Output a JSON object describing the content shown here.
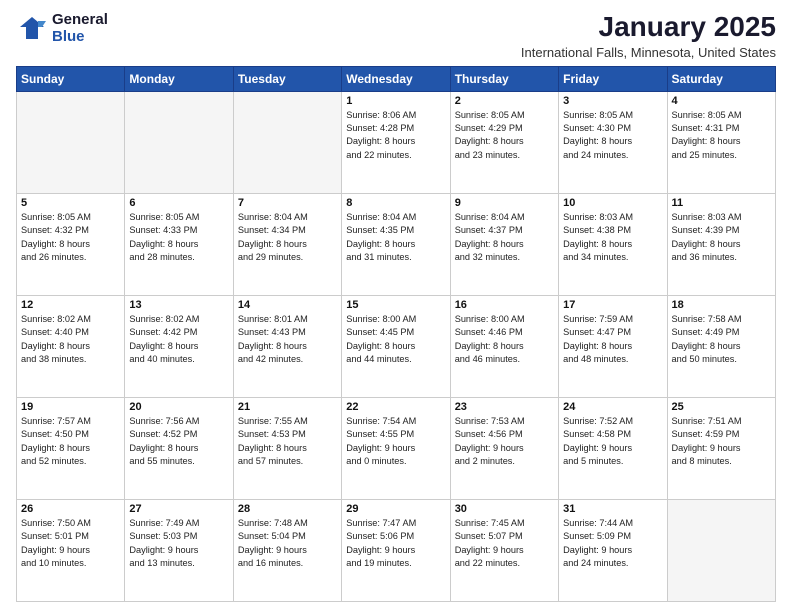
{
  "header": {
    "logo_general": "General",
    "logo_blue": "Blue",
    "month_title": "January 2025",
    "location": "International Falls, Minnesota, United States"
  },
  "days_of_week": [
    "Sunday",
    "Monday",
    "Tuesday",
    "Wednesday",
    "Thursday",
    "Friday",
    "Saturday"
  ],
  "weeks": [
    [
      {
        "day": "",
        "info": ""
      },
      {
        "day": "",
        "info": ""
      },
      {
        "day": "",
        "info": ""
      },
      {
        "day": "1",
        "info": "Sunrise: 8:06 AM\nSunset: 4:28 PM\nDaylight: 8 hours\nand 22 minutes."
      },
      {
        "day": "2",
        "info": "Sunrise: 8:05 AM\nSunset: 4:29 PM\nDaylight: 8 hours\nand 23 minutes."
      },
      {
        "day": "3",
        "info": "Sunrise: 8:05 AM\nSunset: 4:30 PM\nDaylight: 8 hours\nand 24 minutes."
      },
      {
        "day": "4",
        "info": "Sunrise: 8:05 AM\nSunset: 4:31 PM\nDaylight: 8 hours\nand 25 minutes."
      }
    ],
    [
      {
        "day": "5",
        "info": "Sunrise: 8:05 AM\nSunset: 4:32 PM\nDaylight: 8 hours\nand 26 minutes."
      },
      {
        "day": "6",
        "info": "Sunrise: 8:05 AM\nSunset: 4:33 PM\nDaylight: 8 hours\nand 28 minutes."
      },
      {
        "day": "7",
        "info": "Sunrise: 8:04 AM\nSunset: 4:34 PM\nDaylight: 8 hours\nand 29 minutes."
      },
      {
        "day": "8",
        "info": "Sunrise: 8:04 AM\nSunset: 4:35 PM\nDaylight: 8 hours\nand 31 minutes."
      },
      {
        "day": "9",
        "info": "Sunrise: 8:04 AM\nSunset: 4:37 PM\nDaylight: 8 hours\nand 32 minutes."
      },
      {
        "day": "10",
        "info": "Sunrise: 8:03 AM\nSunset: 4:38 PM\nDaylight: 8 hours\nand 34 minutes."
      },
      {
        "day": "11",
        "info": "Sunrise: 8:03 AM\nSunset: 4:39 PM\nDaylight: 8 hours\nand 36 minutes."
      }
    ],
    [
      {
        "day": "12",
        "info": "Sunrise: 8:02 AM\nSunset: 4:40 PM\nDaylight: 8 hours\nand 38 minutes."
      },
      {
        "day": "13",
        "info": "Sunrise: 8:02 AM\nSunset: 4:42 PM\nDaylight: 8 hours\nand 40 minutes."
      },
      {
        "day": "14",
        "info": "Sunrise: 8:01 AM\nSunset: 4:43 PM\nDaylight: 8 hours\nand 42 minutes."
      },
      {
        "day": "15",
        "info": "Sunrise: 8:00 AM\nSunset: 4:45 PM\nDaylight: 8 hours\nand 44 minutes."
      },
      {
        "day": "16",
        "info": "Sunrise: 8:00 AM\nSunset: 4:46 PM\nDaylight: 8 hours\nand 46 minutes."
      },
      {
        "day": "17",
        "info": "Sunrise: 7:59 AM\nSunset: 4:47 PM\nDaylight: 8 hours\nand 48 minutes."
      },
      {
        "day": "18",
        "info": "Sunrise: 7:58 AM\nSunset: 4:49 PM\nDaylight: 8 hours\nand 50 minutes."
      }
    ],
    [
      {
        "day": "19",
        "info": "Sunrise: 7:57 AM\nSunset: 4:50 PM\nDaylight: 8 hours\nand 52 minutes."
      },
      {
        "day": "20",
        "info": "Sunrise: 7:56 AM\nSunset: 4:52 PM\nDaylight: 8 hours\nand 55 minutes."
      },
      {
        "day": "21",
        "info": "Sunrise: 7:55 AM\nSunset: 4:53 PM\nDaylight: 8 hours\nand 57 minutes."
      },
      {
        "day": "22",
        "info": "Sunrise: 7:54 AM\nSunset: 4:55 PM\nDaylight: 9 hours\nand 0 minutes."
      },
      {
        "day": "23",
        "info": "Sunrise: 7:53 AM\nSunset: 4:56 PM\nDaylight: 9 hours\nand 2 minutes."
      },
      {
        "day": "24",
        "info": "Sunrise: 7:52 AM\nSunset: 4:58 PM\nDaylight: 9 hours\nand 5 minutes."
      },
      {
        "day": "25",
        "info": "Sunrise: 7:51 AM\nSunset: 4:59 PM\nDaylight: 9 hours\nand 8 minutes."
      }
    ],
    [
      {
        "day": "26",
        "info": "Sunrise: 7:50 AM\nSunset: 5:01 PM\nDaylight: 9 hours\nand 10 minutes."
      },
      {
        "day": "27",
        "info": "Sunrise: 7:49 AM\nSunset: 5:03 PM\nDaylight: 9 hours\nand 13 minutes."
      },
      {
        "day": "28",
        "info": "Sunrise: 7:48 AM\nSunset: 5:04 PM\nDaylight: 9 hours\nand 16 minutes."
      },
      {
        "day": "29",
        "info": "Sunrise: 7:47 AM\nSunset: 5:06 PM\nDaylight: 9 hours\nand 19 minutes."
      },
      {
        "day": "30",
        "info": "Sunrise: 7:45 AM\nSunset: 5:07 PM\nDaylight: 9 hours\nand 22 minutes."
      },
      {
        "day": "31",
        "info": "Sunrise: 7:44 AM\nSunset: 5:09 PM\nDaylight: 9 hours\nand 24 minutes."
      },
      {
        "day": "",
        "info": ""
      }
    ]
  ]
}
